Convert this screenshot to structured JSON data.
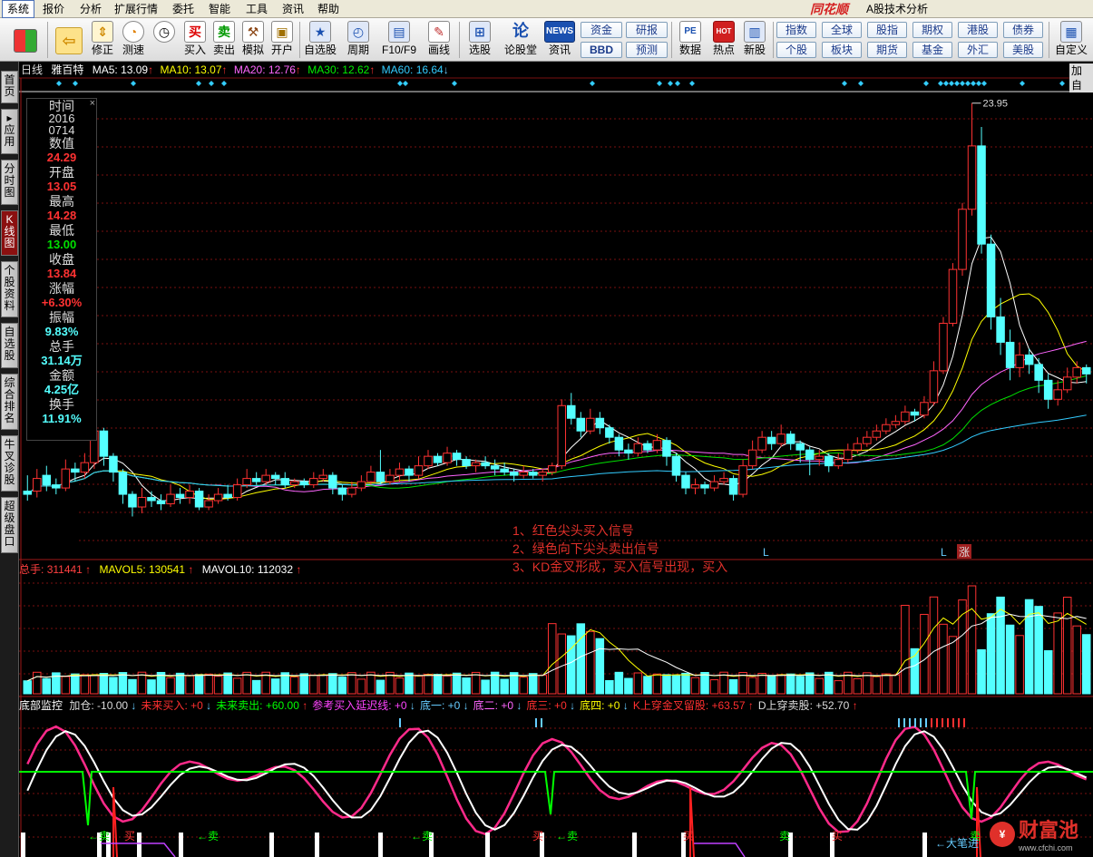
{
  "menu": {
    "items": [
      "系统",
      "报价",
      "分析",
      "扩展行情",
      "委托",
      "智能",
      "工具",
      "资讯",
      "帮助"
    ],
    "brand": "同花顺",
    "app_title": "A股技术分析"
  },
  "toolbar": {
    "buttons": [
      {
        "label": "",
        "icon": "grid-icon"
      },
      {
        "label": "",
        "icon": "back-arrow-icon"
      },
      {
        "label": "修正",
        "icon": "up-down-arrow-icon"
      },
      {
        "label": "测速",
        "icon": "clock-icon"
      },
      {
        "label": "买入",
        "icon": "buy-icon",
        "glyph": "买"
      },
      {
        "label": "卖出",
        "icon": "sell-icon",
        "glyph": "卖"
      },
      {
        "label": "模拟",
        "icon": "hammer-icon"
      },
      {
        "label": "开户",
        "icon": "lock-icon"
      },
      {
        "label": "自选股",
        "icon": "star-icon"
      },
      {
        "label": "周期",
        "icon": "period-icon"
      },
      {
        "label": "F10/F9",
        "icon": "f10-icon"
      },
      {
        "label": "画线",
        "icon": "pen-icon"
      },
      {
        "label": "选股",
        "icon": "select-stock-icon"
      },
      {
        "label": "论股堂",
        "icon": "forum-icon",
        "glyph": "论"
      },
      {
        "label": "资讯",
        "icon": "news-icon",
        "glyph": "NEWS"
      },
      {
        "label": "数据",
        "icon": "pe-icon",
        "glyph": "PE"
      },
      {
        "label": "热点",
        "icon": "hot-icon",
        "glyph": "HOT"
      },
      {
        "label": "新股",
        "icon": "new-stock-icon"
      },
      {
        "label": "自定义",
        "icon": "custom-icon"
      }
    ],
    "mini": {
      "zijin": "资金",
      "bbd": "BBD",
      "yanbao": "研报",
      "yuce": "预测",
      "zhishu": "指数",
      "quanqiu": "全球",
      "guzhi": "股指",
      "qiquan": "期权",
      "ganggu": "港股",
      "zhaiquan": "债券",
      "gegu": "个股",
      "bankuai": "板块",
      "qihuo": "期货",
      "jijin": "基金",
      "waihui": "外汇",
      "meigu": "美股"
    }
  },
  "sidebar": {
    "tabs": [
      "首页",
      "应用",
      "分时图",
      "K线图",
      "个股资料",
      "自选股",
      "综合排名",
      "牛叉诊股",
      "超级盘口"
    ]
  },
  "price_panel": {
    "period": "日线",
    "stock": "雅百特",
    "ma": [
      {
        "name": "MA5",
        "value": "13.09",
        "color": "#ffffff"
      },
      {
        "name": "MA10",
        "value": "13.07",
        "color": "#ffff00"
      },
      {
        "name": "MA20",
        "value": "12.76",
        "color": "#ff66ff"
      },
      {
        "name": "MA30",
        "value": "12.62",
        "color": "#00e000"
      },
      {
        "name": "MA60",
        "value": "16.64",
        "color": "#33ccff"
      }
    ],
    "corner_tag": "加自",
    "max_price": "23.95",
    "marks": [
      "L",
      "L",
      "涨"
    ]
  },
  "legend": {
    "time_label": "时间",
    "date1": "2016",
    "date2": "0714",
    "value_label": "数值",
    "value": "24.29",
    "open_label": "开盘",
    "open": "13.05",
    "high_label": "最高",
    "high": "14.28",
    "low_label": "最低",
    "low": "13.00",
    "close_label": "收盘",
    "close": "13.84",
    "change_label": "涨幅",
    "change": "+6.30%",
    "amp_label": "振幅",
    "amp": "9.83%",
    "vol_label": "总手",
    "vol": "31.14万",
    "amt_label": "金额",
    "amt": "4.25亿",
    "turn_label": "换手",
    "turn": "11.91%"
  },
  "notes": [
    "1、红色尖头买入信号",
    "2、绿色向下尖头卖出信号",
    "3、KD金叉形成，买入信号出现，买入"
  ],
  "volume_panel": {
    "label": "总手",
    "value": "311441",
    "mavol5_label": "MAVOL5",
    "mavol5": "130541",
    "mavol10_label": "MAVOL10",
    "mavol10": "112032"
  },
  "indicator_panel": {
    "name": "底部监控",
    "items": [
      {
        "label": "加仓",
        "value": "-10.00",
        "arrow": "↓",
        "color": "#dddddd"
      },
      {
        "label": "未来买入",
        "value": "+0",
        "arrow": "↓",
        "color": "#ff3030"
      },
      {
        "label": "未来卖出",
        "value": "+60.00",
        "arrow": "↑",
        "color": "#00ff00"
      },
      {
        "label": "参考买入延迟线",
        "value": "+0",
        "arrow": "↓",
        "color": "#ff44ff"
      },
      {
        "label": "底一",
        "value": "+0",
        "arrow": "↓",
        "color": "#66ccff"
      },
      {
        "label": "底二",
        "value": "+0",
        "arrow": "↓",
        "color": "#ff66ff"
      },
      {
        "label": "底三",
        "value": "+0",
        "arrow": "↓",
        "color": "#ff3030"
      },
      {
        "label": "底四",
        "value": "+0",
        "arrow": "↓",
        "color": "#ffff00"
      },
      {
        "label": "K上穿金叉留股",
        "value": "+63.57",
        "arrow": "↑",
        "color": "#ff3030"
      },
      {
        "label": "D上穿卖股",
        "value": "+52.70",
        "arrow": "↑",
        "color": "#dddddd"
      }
    ],
    "signals": {
      "sell": "卖",
      "buy": "买",
      "big": "大笔进"
    }
  },
  "watermark": {
    "text": "财富池",
    "url": "www.cfchi.com"
  },
  "colors": {
    "up": "#ff3232",
    "down": "#54ffff",
    "grid": "#7a1010",
    "bg": "#000000"
  },
  "chart_data": {
    "type": "candlestick",
    "title": "雅百特 日线",
    "max_label": "23.95",
    "candles": [
      [
        11.7,
        11.6,
        12.2,
        11.4
      ],
      [
        11.7,
        12.1,
        12.4,
        11.5
      ],
      [
        12.2,
        11.9,
        12.5,
        11.7
      ],
      [
        11.9,
        11.8,
        12.1,
        11.6
      ],
      [
        11.8,
        12.4,
        12.7,
        11.7
      ],
      [
        12.4,
        12.3,
        12.6,
        12.0
      ],
      [
        12.3,
        12.6,
        12.9,
        12.1
      ],
      [
        12.6,
        13.6,
        13.9,
        12.4
      ],
      [
        13.6,
        12.8,
        13.7,
        12.5
      ],
      [
        12.8,
        12.3,
        12.9,
        12.0
      ],
      [
        12.3,
        11.6,
        12.4,
        11.3
      ],
      [
        11.6,
        11.2,
        11.7,
        10.9
      ],
      [
        11.2,
        11.5,
        11.8,
        11.0
      ],
      [
        11.5,
        11.4,
        11.7,
        11.2
      ],
      [
        11.4,
        11.3,
        11.6,
        11.1
      ],
      [
        11.3,
        11.6,
        11.9,
        11.2
      ],
      [
        11.6,
        11.5,
        11.8,
        11.3
      ],
      [
        11.5,
        11.7,
        11.9,
        11.3
      ],
      [
        11.7,
        11.2,
        11.8,
        11.1
      ],
      [
        11.2,
        11.4,
        11.6,
        11.1
      ],
      [
        11.4,
        11.6,
        11.8,
        11.3
      ],
      [
        11.6,
        11.5,
        11.9,
        11.4
      ],
      [
        11.5,
        11.9,
        12.1,
        11.4
      ],
      [
        11.9,
        12.1,
        12.4,
        11.8
      ],
      [
        12.1,
        12.0,
        12.3,
        11.9
      ],
      [
        12.0,
        12.2,
        12.4,
        11.9
      ],
      [
        12.2,
        12.1,
        12.3,
        11.9
      ],
      [
        12.1,
        11.9,
        12.3,
        11.8
      ],
      [
        11.9,
        12.0,
        12.1,
        11.8
      ],
      [
        12.0,
        11.9,
        12.1,
        11.8
      ],
      [
        11.9,
        12.1,
        12.3,
        11.8
      ],
      [
        12.1,
        12.2,
        12.4,
        12.0
      ],
      [
        12.2,
        11.8,
        12.3,
        11.6
      ],
      [
        11.8,
        11.6,
        11.9,
        11.4
      ],
      [
        11.6,
        11.8,
        12.0,
        11.5
      ],
      [
        11.8,
        12.0,
        12.2,
        11.7
      ],
      [
        12.0,
        12.3,
        12.5,
        11.9
      ],
      [
        12.3,
        12.0,
        13.0,
        11.9
      ],
      [
        12.0,
        12.2,
        12.4,
        11.9
      ],
      [
        12.2,
        12.4,
        12.6,
        12.0
      ],
      [
        12.4,
        12.2,
        12.5,
        12.0
      ],
      [
        12.2,
        12.5,
        12.8,
        12.1
      ],
      [
        12.5,
        12.8,
        13.0,
        12.4
      ],
      [
        12.8,
        12.6,
        12.9,
        12.5
      ],
      [
        12.6,
        12.9,
        13.1,
        12.5
      ],
      [
        12.9,
        12.7,
        13.0,
        12.5
      ],
      [
        12.7,
        12.5,
        12.8,
        12.4
      ],
      [
        12.5,
        12.6,
        12.7,
        12.3
      ],
      [
        12.6,
        12.5,
        12.8,
        12.4
      ],
      [
        12.5,
        12.4,
        12.7,
        12.2
      ],
      [
        12.4,
        12.3,
        12.6,
        12.2
      ],
      [
        12.3,
        12.2,
        12.4,
        12.0
      ],
      [
        12.2,
        12.3,
        12.5,
        12.1
      ],
      [
        12.3,
        12.2,
        12.4,
        12.1
      ],
      [
        12.2,
        12.3,
        12.4,
        12.0
      ],
      [
        12.3,
        12.5,
        12.6,
        12.2
      ],
      [
        12.5,
        14.4,
        14.6,
        12.4
      ],
      [
        14.4,
        14.0,
        14.8,
        13.8
      ],
      [
        14.0,
        13.6,
        14.2,
        13.4
      ],
      [
        13.6,
        14.0,
        14.3,
        13.5
      ],
      [
        14.0,
        13.7,
        14.2,
        13.5
      ],
      [
        13.7,
        13.4,
        13.8,
        13.2
      ],
      [
        13.4,
        13.0,
        13.5,
        12.8
      ],
      [
        13.0,
        12.9,
        13.2,
        12.7
      ],
      [
        12.9,
        13.2,
        13.4,
        12.8
      ],
      [
        13.2,
        13.0,
        13.3,
        12.9
      ],
      [
        13.0,
        13.3,
        13.5,
        12.9
      ],
      [
        13.3,
        12.8,
        13.4,
        12.5
      ],
      [
        12.8,
        12.2,
        12.9,
        12.0
      ],
      [
        12.2,
        11.8,
        12.3,
        11.6
      ],
      [
        11.8,
        11.9,
        12.1,
        11.6
      ],
      [
        11.9,
        11.8,
        12.0,
        11.6
      ],
      [
        11.8,
        12.0,
        12.2,
        11.7
      ],
      [
        12.0,
        12.1,
        12.3,
        11.9
      ],
      [
        12.1,
        11.6,
        12.2,
        11.4
      ],
      [
        11.6,
        12.5,
        12.7,
        11.5
      ],
      [
        12.5,
        13.0,
        13.3,
        12.4
      ],
      [
        13.0,
        13.4,
        13.6,
        12.9
      ],
      [
        13.4,
        13.2,
        13.6,
        13.0
      ],
      [
        13.2,
        13.5,
        13.8,
        13.1
      ],
      [
        13.5,
        13.2,
        13.6,
        13.0
      ],
      [
        13.2,
        13.0,
        13.3,
        12.6
      ],
      [
        13.0,
        12.7,
        13.1,
        12.2
      ],
      [
        12.7,
        12.8,
        13.0,
        12.5
      ],
      [
        12.8,
        12.5,
        12.9,
        12.3
      ],
      [
        12.5,
        12.7,
        12.9,
        12.4
      ],
      [
        12.7,
        13.0,
        13.2,
        12.6
      ],
      [
        13.0,
        13.2,
        13.4,
        12.9
      ],
      [
        13.2,
        13.4,
        13.6,
        13.1
      ],
      [
        13.4,
        13.6,
        13.8,
        13.3
      ],
      [
        13.6,
        13.8,
        14.0,
        13.5
      ],
      [
        13.8,
        13.9,
        14.1,
        13.7
      ],
      [
        13.9,
        14.2,
        14.4,
        13.8
      ],
      [
        14.2,
        14.1,
        14.3,
        13.9
      ],
      [
        14.1,
        14.5,
        14.7,
        14.0
      ],
      [
        14.5,
        15.5,
        15.8,
        14.4
      ],
      [
        15.5,
        17.0,
        17.2,
        15.4
      ],
      [
        17.0,
        18.7,
        18.9,
        16.9
      ],
      [
        18.7,
        20.6,
        20.8,
        18.5
      ],
      [
        20.6,
        22.6,
        23.95,
        20.4
      ],
      [
        22.6,
        19.5,
        23.2,
        19.2
      ],
      [
        19.5,
        17.2,
        19.8,
        16.8
      ],
      [
        17.2,
        16.4,
        17.8,
        16.0
      ],
      [
        16.4,
        15.6,
        16.8,
        15.2
      ],
      [
        15.6,
        16.0,
        16.4,
        15.3
      ],
      [
        16.0,
        15.7,
        16.2,
        15.4
      ],
      [
        15.7,
        15.2,
        15.9,
        14.8
      ],
      [
        15.2,
        14.6,
        15.4,
        14.3
      ],
      [
        14.6,
        14.9,
        15.2,
        14.4
      ],
      [
        14.9,
        15.3,
        15.6,
        14.8
      ],
      [
        15.3,
        15.6,
        15.8,
        15.1
      ],
      [
        15.6,
        15.4,
        15.7,
        15.1
      ]
    ]
  }
}
